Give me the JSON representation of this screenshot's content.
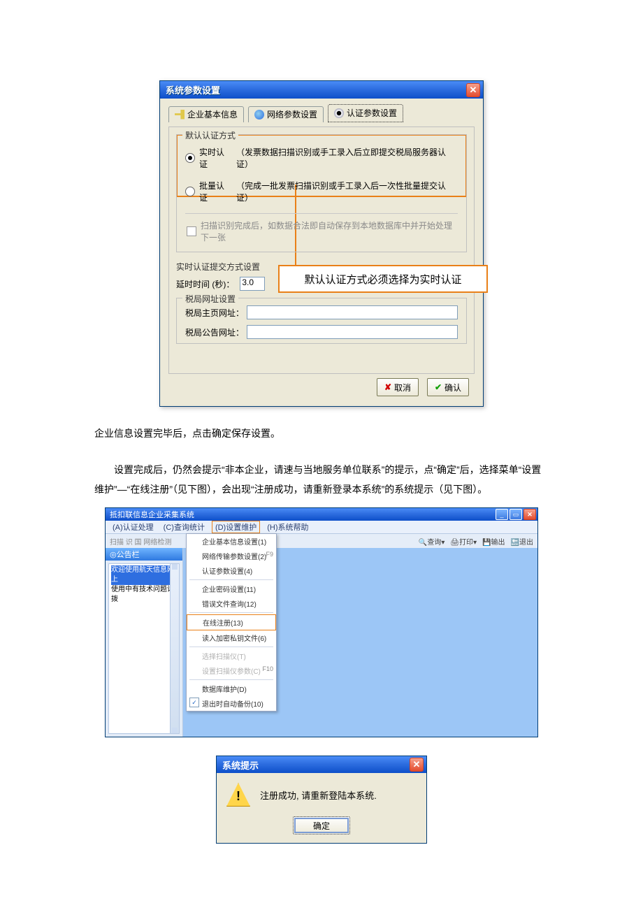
{
  "win1": {
    "title": "系统参数设置",
    "tabs": {
      "t1": "企业基本信息",
      "t2": "网络参数设置",
      "t3": "认证参数设置"
    },
    "group1": {
      "legend": "默认认证方式",
      "r1_label": "实时认证",
      "r1_desc": "（发票数据扫描识别或手工录入后立即提交税局服务器认证）",
      "r2_label": "批量认证",
      "r2_desc": "（完成一批发票扫描识别或手工录入后一次性批量提交认证）",
      "chk": "扫描识别完成后，如数据合法即自动保存到本地数据库中并开始处理下一张"
    },
    "group2": {
      "legend": "实时认证提交方式设置",
      "delay_label": "延时时间 (秒)：",
      "delay_value": "3.0"
    },
    "group3": {
      "legend": "税局网址设置",
      "home_label": "税局主页网址：",
      "bulletin_label": "税局公告网址："
    },
    "btn_cancel": "取消",
    "btn_ok": "确认",
    "callout": "默认认证方式必须选择为实时认证"
  },
  "para1": "企业信息设置完毕后，点击确定保存设置。",
  "para2": "设置完成后，仍然会提示“非本企业，请速与当地服务单位联系”的提示，点“确定”后，选择菜单“设置维护”—“在线注册”（见下图），会出现“注册成功，请重新登录本系统”的系统提示（见下图）。",
  "win2": {
    "title": "抵扣联信息企业采集系统",
    "menus": {
      "m1": "(A)认证处理",
      "m2": "(C)查询统计",
      "m3": "(D)设置维护",
      "m4": "(H)系统帮助"
    },
    "toolbar": {
      "left": "扫描 识 国 网络检测",
      "r1": "查询",
      "r2": "打印",
      "r3": "输出",
      "r4": "退出"
    },
    "side": {
      "hdr": "公告栏",
      "l1": "欢迎使用航天信息网上",
      "l2": "使用中有技术问题请拨"
    },
    "drop": {
      "d1": "企业基本信息设置(1)",
      "d2": "网络传输参数设置(2)",
      "d2acc": "F9",
      "d3": "认证参数设置(4)",
      "d4": "企业密码设置(11)",
      "d5": "错误文件查询(12)",
      "d6": "在线注册(13)",
      "d7": "读入加密私钥文件(6)",
      "d8": "选择扫描仪(T)",
      "d9": "设置扫描仪参数(C)",
      "d9acc": "F10",
      "d10": "数据库维护(D)",
      "d11": "退出时自动备份(10)"
    }
  },
  "win3": {
    "title": "系统提示",
    "msg": "注册成功, 请重新登陆本系统.",
    "ok": "确定"
  }
}
